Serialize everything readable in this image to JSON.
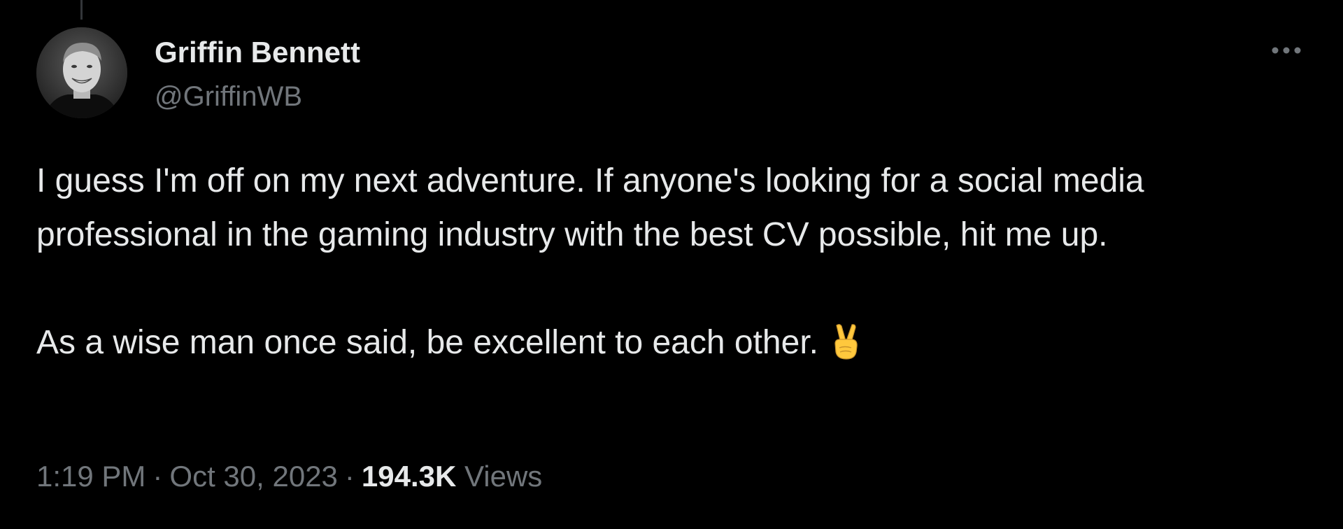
{
  "tweet": {
    "author": {
      "name": "Griffin Bennett",
      "handle": "@GriffinWB",
      "avatar_icon": "profile-photo"
    },
    "more_icon": "ellipsis-icon",
    "body": {
      "paragraph1": "I guess I'm off on my next adventure. If anyone's looking for a social media professional in the gaming industry with the best CV possible, hit me up.",
      "paragraph2": "As a wise man once said, be excellent to each other.",
      "emoji": "victory-hand"
    },
    "meta": {
      "time": "1:19 PM",
      "separator": "·",
      "date": "Oct 30, 2023",
      "views_count": "194.3K",
      "views_label": "Views"
    }
  },
  "colors": {
    "background": "#000000",
    "primary_text": "#e7e9ea",
    "secondary_text": "#71767b",
    "thread_line": "#333639"
  }
}
